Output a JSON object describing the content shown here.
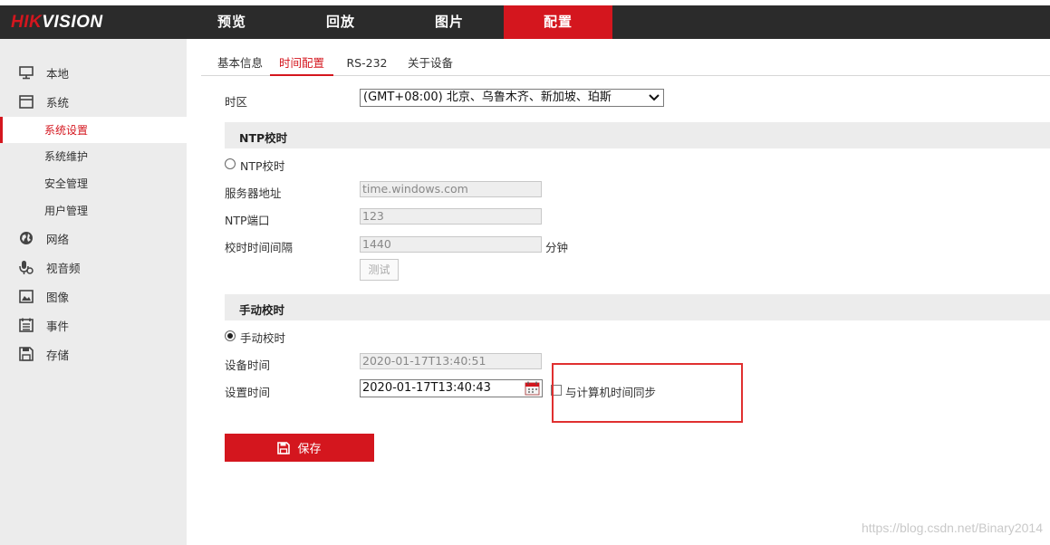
{
  "brand": {
    "logo_part1": "HIK",
    "logo_part2": "VISION"
  },
  "nav": {
    "items": [
      "预览",
      "回放",
      "图片",
      "配置"
    ],
    "active": "配置"
  },
  "sidebar": {
    "items": [
      {
        "label": "本地",
        "icon": "monitor-icon"
      },
      {
        "label": "系统",
        "icon": "system-icon"
      },
      {
        "label": "网络",
        "icon": "globe-icon"
      },
      {
        "label": "视音频",
        "icon": "microphone-icon"
      },
      {
        "label": "图像",
        "icon": "image-icon"
      },
      {
        "label": "事件",
        "icon": "calendar-list-icon"
      },
      {
        "label": "存储",
        "icon": "floppy-disk-icon"
      }
    ],
    "sub_items": [
      {
        "label": "系统设置",
        "active": true
      },
      {
        "label": "系统维护"
      },
      {
        "label": "安全管理"
      },
      {
        "label": "用户管理"
      }
    ]
  },
  "tabs": {
    "items": [
      "基本信息",
      "时间配置",
      "RS-232",
      "关于设备"
    ],
    "active": "时间配置"
  },
  "timezone": {
    "label": "时区",
    "value": "(GMT+08:00) 北京、乌鲁木齐、新加坡、珀斯"
  },
  "ntp": {
    "section_title": "NTP校时",
    "radio_label": "NTP校时",
    "selected": false,
    "server_label": "服务器地址",
    "server_value": "time.windows.com",
    "port_label": "NTP端口",
    "port_value": "123",
    "interval_label": "校时时间间隔",
    "interval_value": "1440",
    "interval_unit": "分钟",
    "test_button": "测试"
  },
  "manual": {
    "section_title": "手动校时",
    "radio_label": "手动校时",
    "selected": true,
    "device_time_label": "设备时间",
    "device_time_value": "2020-01-17T13:40:51",
    "set_time_label": "设置时间",
    "set_time_value": "2020-01-17T13:40:43",
    "sync_label": "与计算机时间同步",
    "sync_checked": false
  },
  "save_button": "保存",
  "watermark": "https://blog.csdn.net/Binary2014",
  "colors": {
    "accent": "#d4161e",
    "topbar": "#2b2b2b",
    "sidebar": "#ececec",
    "annotation": "#e03030"
  }
}
